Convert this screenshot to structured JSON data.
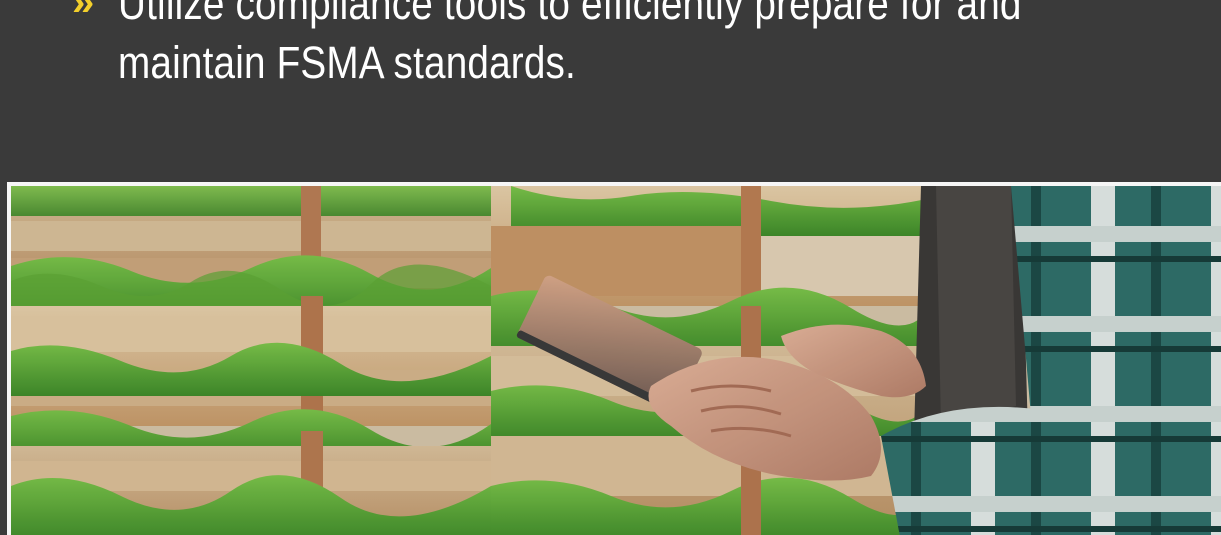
{
  "slide": {
    "bullet_glyph": "»",
    "bullet_text_line1": "Utilize compliance tools to efficiently prepare for and",
    "bullet_text_line2": "maintain FSMA standards."
  },
  "colors": {
    "background": "#3a3a3a",
    "bullet_accent": "#f3cf2b",
    "text": "#ffffff",
    "frame": "#f6f6f6"
  },
  "photo": {
    "subject": "produce-crates-with-tablet"
  }
}
